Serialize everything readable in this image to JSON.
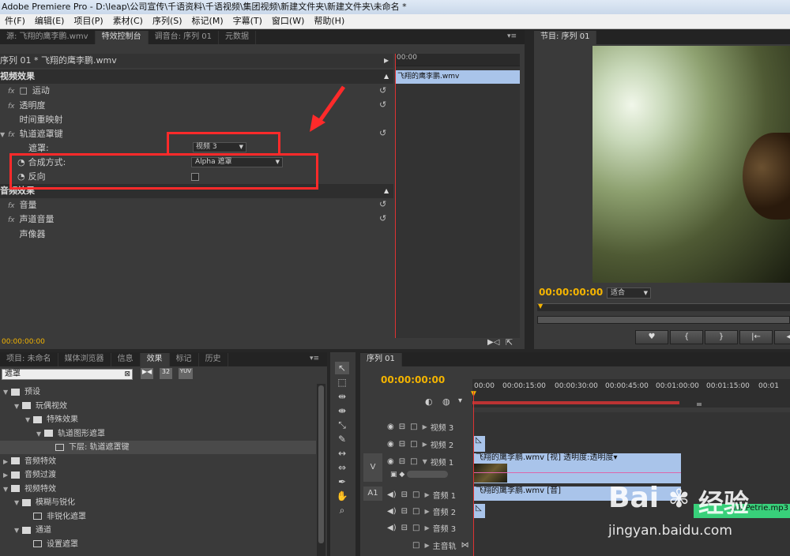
{
  "window": {
    "title": "Adobe Premiere Pro - D:\\leap\\公司宣传\\千语资料\\千语视频\\集团视频\\新建文件夹\\新建文件夹\\未命名 *"
  },
  "menu": [
    "件(F)",
    "编辑(E)",
    "项目(P)",
    "素材(C)",
    "序列(S)",
    "标记(M)",
    "字幕(T)",
    "窗口(W)",
    "帮助(H)"
  ],
  "source_tabs": [
    "源: 飞翔的鹰李鹏.wmv",
    "特效控制台",
    "调音台: 序列 01",
    "元数据"
  ],
  "effects_panel": {
    "clip_header": "序列 01 * 飞翔的鹰李鹏.wmv",
    "video_section": "视频效果",
    "motion": "运动",
    "opacity": "透明度",
    "time_remap": "时间重映射",
    "track_matte": "轨道遮罩键",
    "matte_label": "遮罩:",
    "matte_value": "视频 3",
    "composite_label": "合成方式:",
    "composite_value": "Alpha 遮罩",
    "reverse_label": "反向",
    "audio_section": "音频效果",
    "volume": "音量",
    "channel_volume": "声道音量",
    "panner": "声像器",
    "timecode_ruler": "00:00",
    "clip_label": "飞翔的鹰李鹏.wmv",
    "bottom_timecode": "00:00:00:00"
  },
  "program": {
    "tab": "节目: 序列 01",
    "timecode": "00:00:00:00",
    "fit": "适合"
  },
  "project_tabs": [
    "项目: 未命名",
    "媒体浏览器",
    "信息",
    "效果",
    "标记",
    "历史"
  ],
  "search_value": "遮罩",
  "tree": [
    {
      "label": "预设",
      "indent": 0,
      "open": true
    },
    {
      "label": "玩偶视效",
      "indent": 1,
      "open": true
    },
    {
      "label": "特殊效果",
      "indent": 2,
      "open": true
    },
    {
      "label": "轨道图形遮罩",
      "indent": 3,
      "open": true
    },
    {
      "label": "下层: 轨道遮罩键",
      "indent": 4,
      "leaf": true,
      "selected": true
    },
    {
      "label": "音频特效",
      "indent": 0
    },
    {
      "label": "音频过渡",
      "indent": 0
    },
    {
      "label": "视频特效",
      "indent": 0,
      "open": true
    },
    {
      "label": "模糊与锐化",
      "indent": 1,
      "open": true
    },
    {
      "label": "非锐化遮罩",
      "indent": 2,
      "leaf": true
    },
    {
      "label": "通道",
      "indent": 1,
      "open": true
    },
    {
      "label": "设置遮罩",
      "indent": 2,
      "leaf": true
    }
  ],
  "timeline": {
    "tab": "序列 01",
    "timecode": "00:00:00:00",
    "ruler": [
      "00:00",
      "00:00:15:00",
      "00:00:30:00",
      "00:00:45:00",
      "00:01:00:00",
      "00:01:15:00",
      "00:01"
    ],
    "tracks": {
      "v3": "视频 3",
      "v2": "视频 2",
      "v1": "视频 1",
      "a1": "音频 1",
      "a2": "音频 2",
      "a3": "音频 3",
      "master": "主音轨"
    },
    "v_label": "V",
    "a_label": "A1",
    "video_clip": "飞翔的鹰李鹏.wmv [视] 透明度:透明度",
    "audio_clip": "飞翔的鹰李鹏.wmv [音]",
    "mp3_clip": "ark Petrie.mp3"
  },
  "watermark": {
    "brand": "Bai",
    "brand2": "经验",
    "url": "jingyan.baidu.com"
  }
}
